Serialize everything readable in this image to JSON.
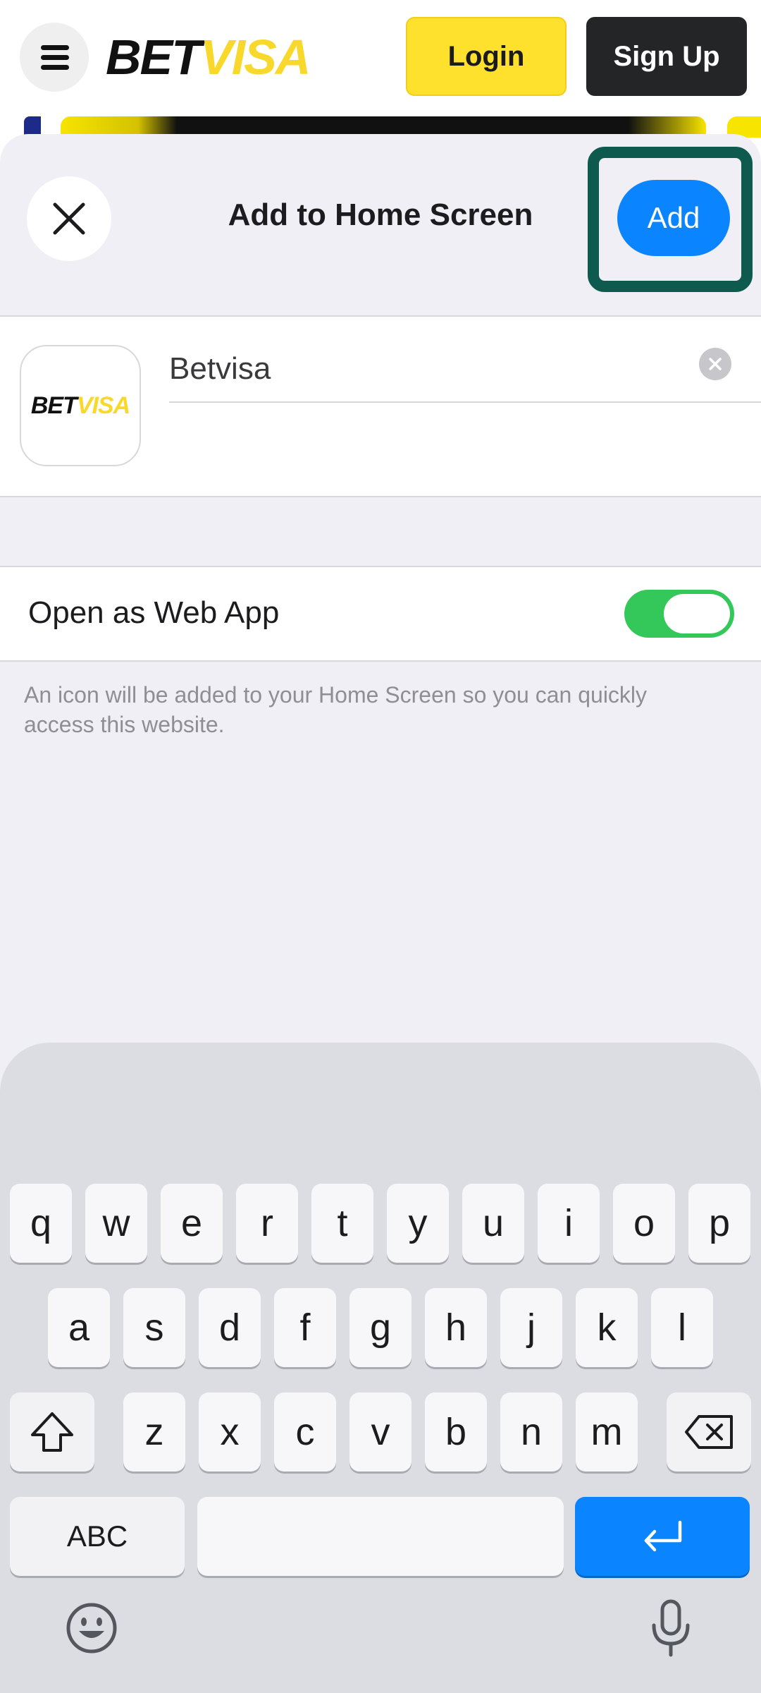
{
  "site_header": {
    "logo_part1": "BET",
    "logo_part2": "VISA",
    "login_label": "Login",
    "signup_label": "Sign Up"
  },
  "sheet": {
    "title": "Add to Home Screen",
    "add_label": "Add",
    "app_name_value": "Betvisa",
    "app_icon_part1": "BET",
    "app_icon_part2": "VISA",
    "web_app_label": "Open as Web App",
    "web_app_enabled": true,
    "footnote": "An icon will be added to your Home Screen so you can quickly access this website."
  },
  "keyboard": {
    "row1": [
      "q",
      "w",
      "e",
      "r",
      "t",
      "y",
      "u",
      "i",
      "o",
      "p"
    ],
    "row2": [
      "a",
      "s",
      "d",
      "f",
      "g",
      "h",
      "j",
      "k",
      "l"
    ],
    "row3": [
      "z",
      "x",
      "c",
      "v",
      "b",
      "n",
      "m"
    ],
    "abc_label": "ABC",
    "icons": [
      "shift-icon",
      "backspace-icon",
      "return-icon",
      "emoji-icon",
      "microphone-icon"
    ]
  },
  "colors": {
    "brand_yellow": "#fde12c",
    "brand_dark": "#232527",
    "ios_blue": "#0a84ff",
    "toggle_green": "#34c759",
    "highlight_green": "#0e5a4f"
  }
}
